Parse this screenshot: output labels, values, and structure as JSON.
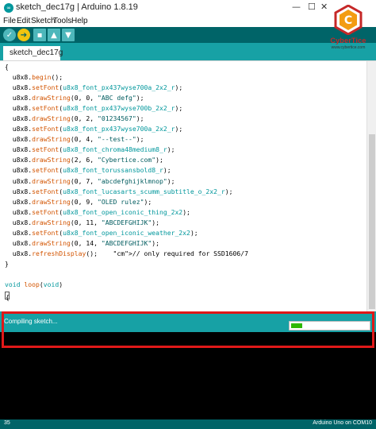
{
  "window": {
    "title": "sketch_dec17g | Arduino 1.8.19",
    "app_icon_glyph": "∞",
    "minimize_glyph": "—",
    "maximize_glyph": "☐",
    "close_glyph": "✕"
  },
  "menu": [
    "File",
    "Edit",
    "Sketch",
    "Tools",
    "Help"
  ],
  "toolbar": {
    "verify_icon": "check-icon",
    "upload_icon": "arrow-right-icon",
    "new_icon": "new-file-icon",
    "open_icon": "arrow-up-icon",
    "save_icon": "arrow-down-icon",
    "verify_glyph": "✓",
    "upload_glyph": "➔",
    "new_glyph": "▪",
    "open_glyph": "▲",
    "save_glyph": "▼"
  },
  "logo": {
    "name": "CyberTice",
    "url": "www.cybertice.com",
    "letter": "C",
    "accent": "#c62828",
    "secondary": "#f39c12"
  },
  "tab": {
    "label": "sketch_dec17g §"
  },
  "editor": {
    "lines": [
      "{",
      "  u8x8.begin();",
      "  u8x8.setFont(u8x8_font_px437wyse700a_2x2_r);",
      "  u8x8.drawString(0, 0, \"ABC defg\");",
      "  u8x8.setFont(u8x8_font_px437wyse700b_2x2_r);",
      "  u8x8.drawString(0, 2, \"01234567\");",
      "  u8x8.setFont(u8x8_font_px437wyse700a_2x2_r);",
      "  u8x8.drawString(0, 4, \"--test--\");",
      "  u8x8.setFont(u8x8_font_chroma48medium8_r);",
      "  u8x8.drawString(2, 6, \"Cybertice.com\");",
      "  u8x8.setFont(u8x8_font_torussansbold8_r);",
      "  u8x8.drawString(0, 7, \"abcdefghijklmnop\");",
      "  u8x8.setFont(u8x8_font_lucasarts_scumm_subtitle_o_2x2_r);",
      "  u8x8.drawString(0, 9, \"OLED rulez\");",
      "  u8x8.setFont(u8x8_font_open_iconic_thing_2x2);",
      "  u8x8.drawString(0, 11, \"ABCDEFGHIJK\");",
      "  u8x8.setFont(u8x8_font_open_iconic_weather_2x2);",
      "  u8x8.drawString(0, 14, \"ABCDEFGHIJK\");",
      "  u8x8.refreshDisplay();    // only required for SSD1606/7",
      "}",
      "",
      "void loop(void)",
      "{",
      "",
      "",
      "}"
    ]
  },
  "status": {
    "message": "Compiling sketch...",
    "progress_fraction": 0.14
  },
  "footer": {
    "line_number": "35",
    "board": "Arduino Uno on COM10"
  }
}
